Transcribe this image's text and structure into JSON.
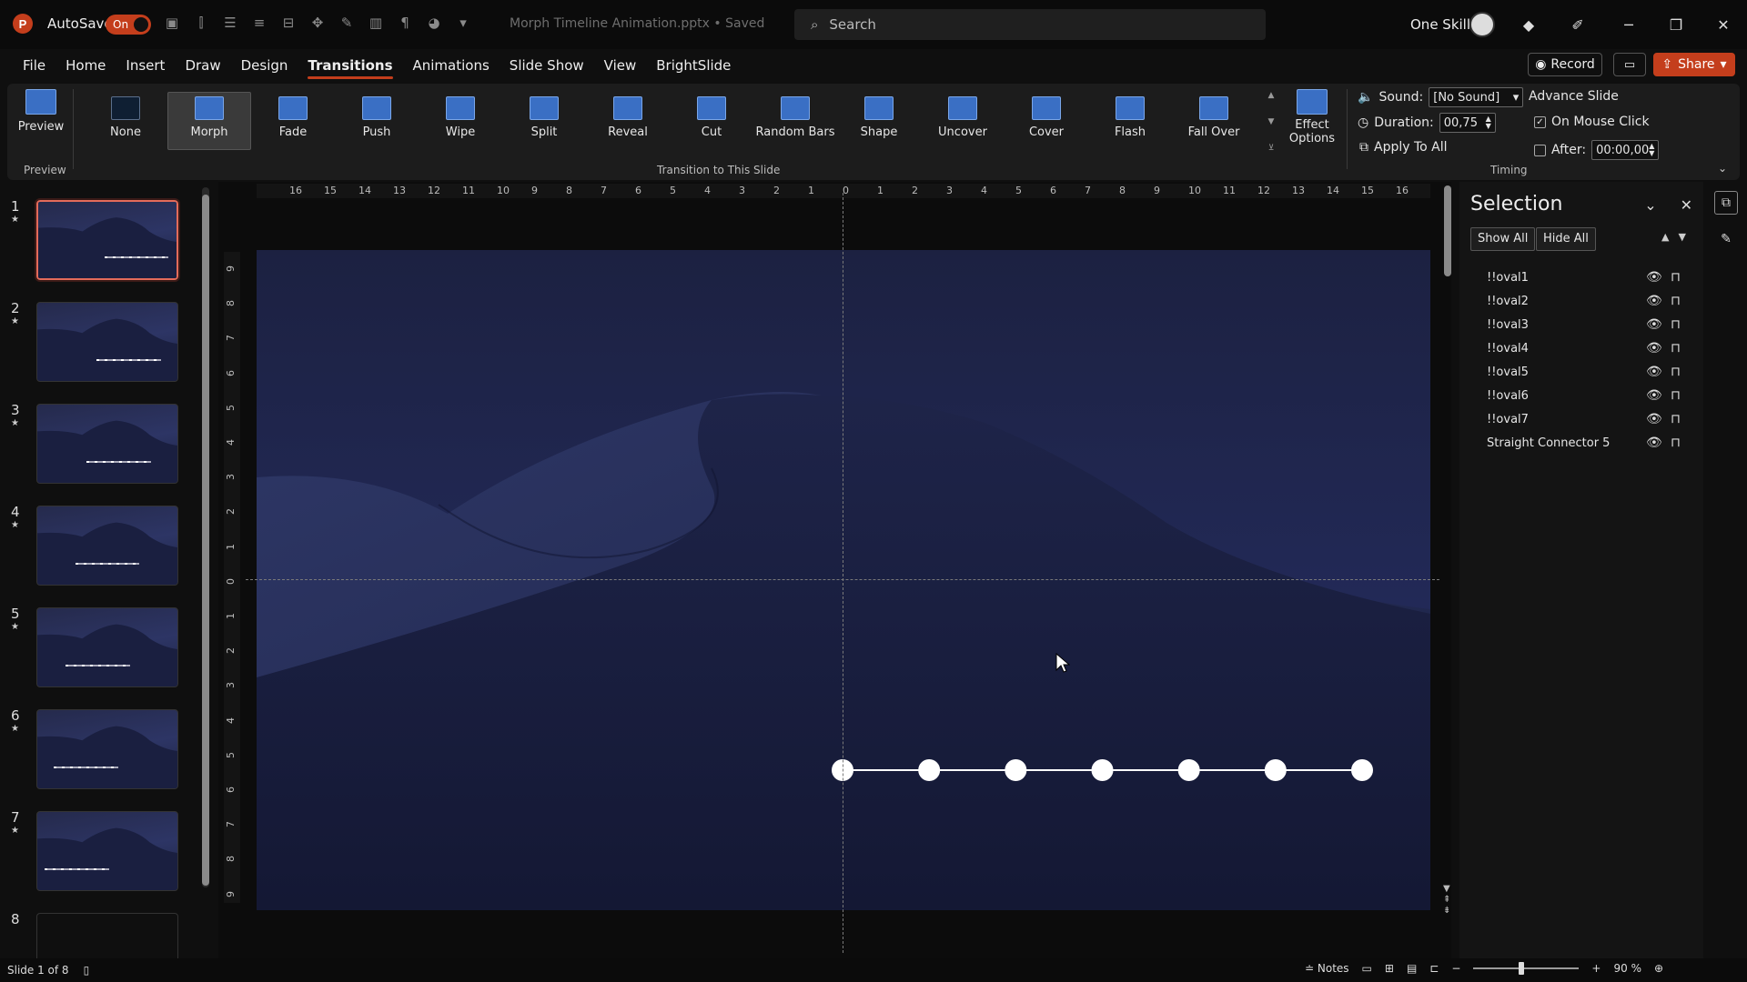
{
  "titlebar": {
    "logo_letter": "P",
    "autosave_label": "AutoSave",
    "autosave_state": "On",
    "doc_title": "Morph Timeline Animation.pptx • Saved",
    "search_placeholder": "Search",
    "account_name": "One Skill"
  },
  "menu": {
    "tabs": [
      "File",
      "Home",
      "Insert",
      "Draw",
      "Design",
      "Transitions",
      "Animations",
      "Slide Show",
      "View",
      "BrightSlide"
    ],
    "active_tab": "Transitions",
    "record_label": "Record",
    "share_label": "Share"
  },
  "ribbon": {
    "preview_label": "Preview",
    "preview_group": "Preview",
    "transitions": [
      "None",
      "Morph",
      "Fade",
      "Push",
      "Wipe",
      "Split",
      "Reveal",
      "Cut",
      "Random Bars",
      "Shape",
      "Uncover",
      "Cover",
      "Flash",
      "Fall Over"
    ],
    "selected_transition": "Morph",
    "effect_options_line1": "Effect",
    "effect_options_line2": "Options",
    "transition_group": "Transition to This Slide",
    "sound_label": "Sound:",
    "sound_value": "[No Sound]",
    "duration_label": "Duration:",
    "duration_value": "00,75",
    "apply_all_label": "Apply To All",
    "advance_label": "Advance Slide",
    "on_click_label": "On Mouse Click",
    "on_click_checked": true,
    "after_label": "After:",
    "after_value": "00:00,00",
    "timing_group": "Timing"
  },
  "thumbnails": {
    "slides": [
      {
        "num": "1",
        "star": "★",
        "active": true,
        "dots_offset": 0.48,
        "dots_width": 0.46
      },
      {
        "num": "2",
        "star": "★",
        "active": false,
        "dots_offset": 0.42,
        "dots_width": 0.46
      },
      {
        "num": "3",
        "star": "★",
        "active": false,
        "dots_offset": 0.35,
        "dots_width": 0.46
      },
      {
        "num": "4",
        "star": "★",
        "active": false,
        "dots_offset": 0.27,
        "dots_width": 0.46
      },
      {
        "num": "5",
        "star": "★",
        "active": false,
        "dots_offset": 0.2,
        "dots_width": 0.46
      },
      {
        "num": "6",
        "star": "★",
        "active": false,
        "dots_offset": 0.12,
        "dots_width": 0.46
      },
      {
        "num": "7",
        "star": "★",
        "active": false,
        "dots_offset": 0.05,
        "dots_width": 0.46
      },
      {
        "num": "8",
        "star": "",
        "active": false,
        "empty": true
      }
    ]
  },
  "rulers": {
    "horizontal": [
      "16",
      "15",
      "14",
      "13",
      "12",
      "11",
      "10",
      "9",
      "8",
      "7",
      "6",
      "5",
      "4",
      "3",
      "2",
      "1",
      "0",
      "1",
      "2",
      "3",
      "4",
      "5",
      "6",
      "7",
      "8",
      "9",
      "10",
      "11",
      "12",
      "13",
      "14",
      "15",
      "16"
    ],
    "vertical": [
      "9",
      "8",
      "7",
      "6",
      "5",
      "4",
      "3",
      "2",
      "1",
      "0",
      "1",
      "2",
      "3",
      "4",
      "5",
      "6",
      "7",
      "8",
      "9"
    ]
  },
  "slide": {
    "timeline_dots": 7,
    "colors": {
      "sky": "#1f2547",
      "dune_dark": "#161b38",
      "dot": "#ffffff"
    }
  },
  "selection_pane": {
    "title": "Selection",
    "show_all": "Show All",
    "hide_all": "Hide All",
    "items": [
      "!!oval1",
      "!!oval2",
      "!!oval3",
      "!!oval4",
      "!!oval5",
      "!!oval6",
      "!!oval7",
      "Straight Connector 5"
    ]
  },
  "statusbar": {
    "slide_info": "Slide 1 of 8",
    "notes_label": "Notes",
    "zoom": "90 %"
  },
  "colors": {
    "accent": "#c43e1c",
    "selected_thumb_border": "#e46b5a"
  }
}
